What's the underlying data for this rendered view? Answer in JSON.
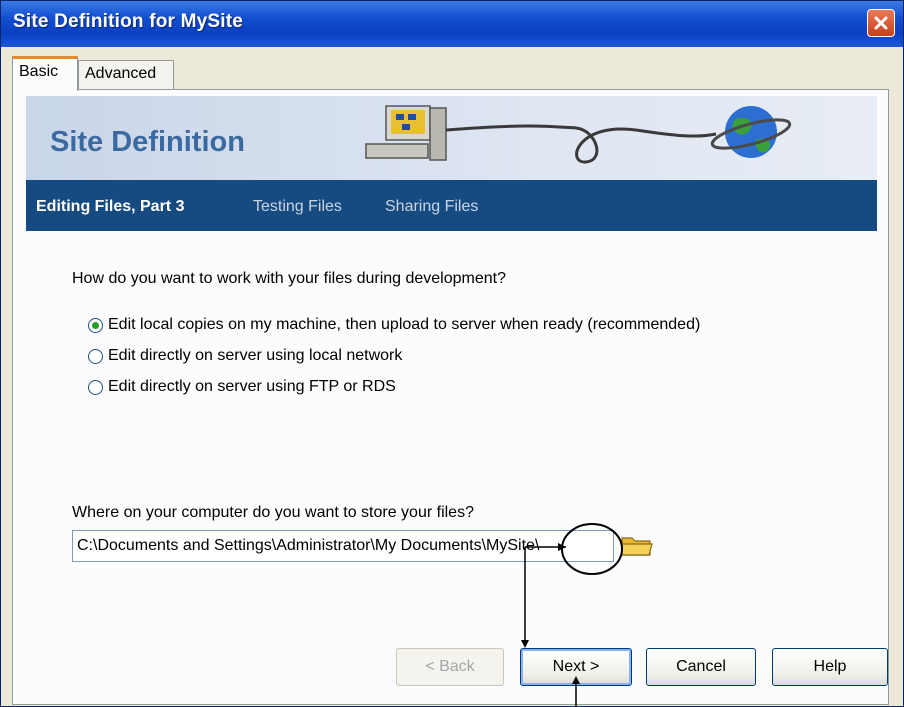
{
  "window": {
    "title": "Site Definition for MySite"
  },
  "tabs": [
    {
      "label": "Basic"
    },
    {
      "label": "Advanced"
    }
  ],
  "banner": {
    "title": "Site Definition"
  },
  "steps": [
    {
      "label": "Editing Files, Part 3"
    },
    {
      "label": "Testing Files"
    },
    {
      "label": "Sharing Files"
    }
  ],
  "question1": "How do you want to work with your files during development?",
  "options": [
    {
      "label": "Edit local copies on my machine, then upload to server when ready (recommended)",
      "selected": true
    },
    {
      "label": "Edit directly on server using local network",
      "selected": false
    },
    {
      "label": "Edit directly on server using FTP or RDS",
      "selected": false
    }
  ],
  "question2": "Where on your computer do you want to store your files?",
  "path": {
    "value": "C:\\Documents and Settings\\Administrator\\My Documents\\MySite\\"
  },
  "buttons": {
    "back": "< Back",
    "next": "Next >",
    "cancel": "Cancel",
    "help": "Help"
  },
  "colors": {
    "titlebar": "#0a3fc0",
    "banner_title": "#3b6aa0",
    "step_bar": "#164b82",
    "selected_dot": "#21a121"
  }
}
